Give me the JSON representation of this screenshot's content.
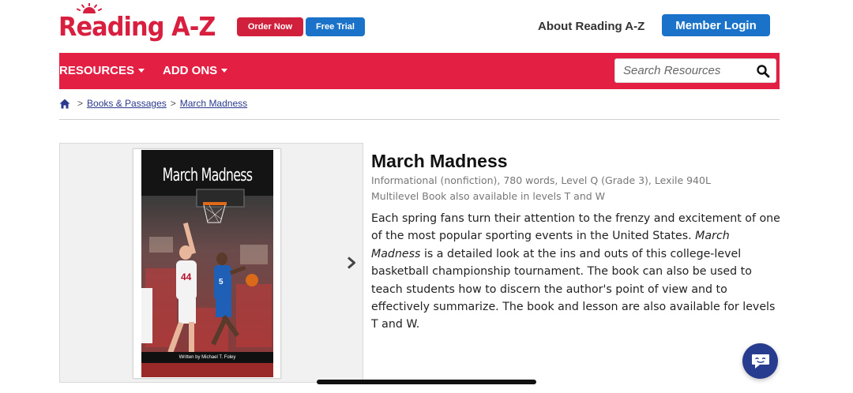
{
  "brand": {
    "logo_text": "Reading A-Z",
    "primary_red": "#e41f44",
    "primary_blue": "#1a73c8"
  },
  "header": {
    "order_now": "Order Now",
    "free_trial": "Free Trial",
    "about": "About Reading A-Z",
    "member_login": "Member Login"
  },
  "nav": {
    "items": [
      {
        "label": "RESOURCES",
        "has_dropdown": true
      },
      {
        "label": "ADD ONS",
        "has_dropdown": true
      }
    ],
    "search": {
      "placeholder": "Search Resources",
      "value": ""
    }
  },
  "breadcrumb": {
    "items": [
      "Books & Passages",
      "March Madness"
    ],
    "separator": ">"
  },
  "book": {
    "cover_title": "March Madness",
    "cover_author": "Written by Michael T. Foley",
    "title": "March Madness",
    "meta_line1": "Informational (nonfiction), 780 words, Level Q (Grade 3), Lexile 940L",
    "meta_line2": "Multilevel Book also available in levels T and W",
    "description_part1": "Each spring fans turn their attention to the frenzy and excitement of one of the most popular sporting events in the United States. ",
    "description_italic": "March Madness",
    "description_part2": " is a detailed look at the ins and outs of this college-level basketball championship tournament. The book can also be used to teach students how to discern the author's point of view and to effectively summarize. The book and lesson are also available for levels T and W."
  },
  "icons": {
    "home": "home-icon",
    "search": "search-icon",
    "next": "chevron-right-icon",
    "chat": "chat-icon"
  }
}
